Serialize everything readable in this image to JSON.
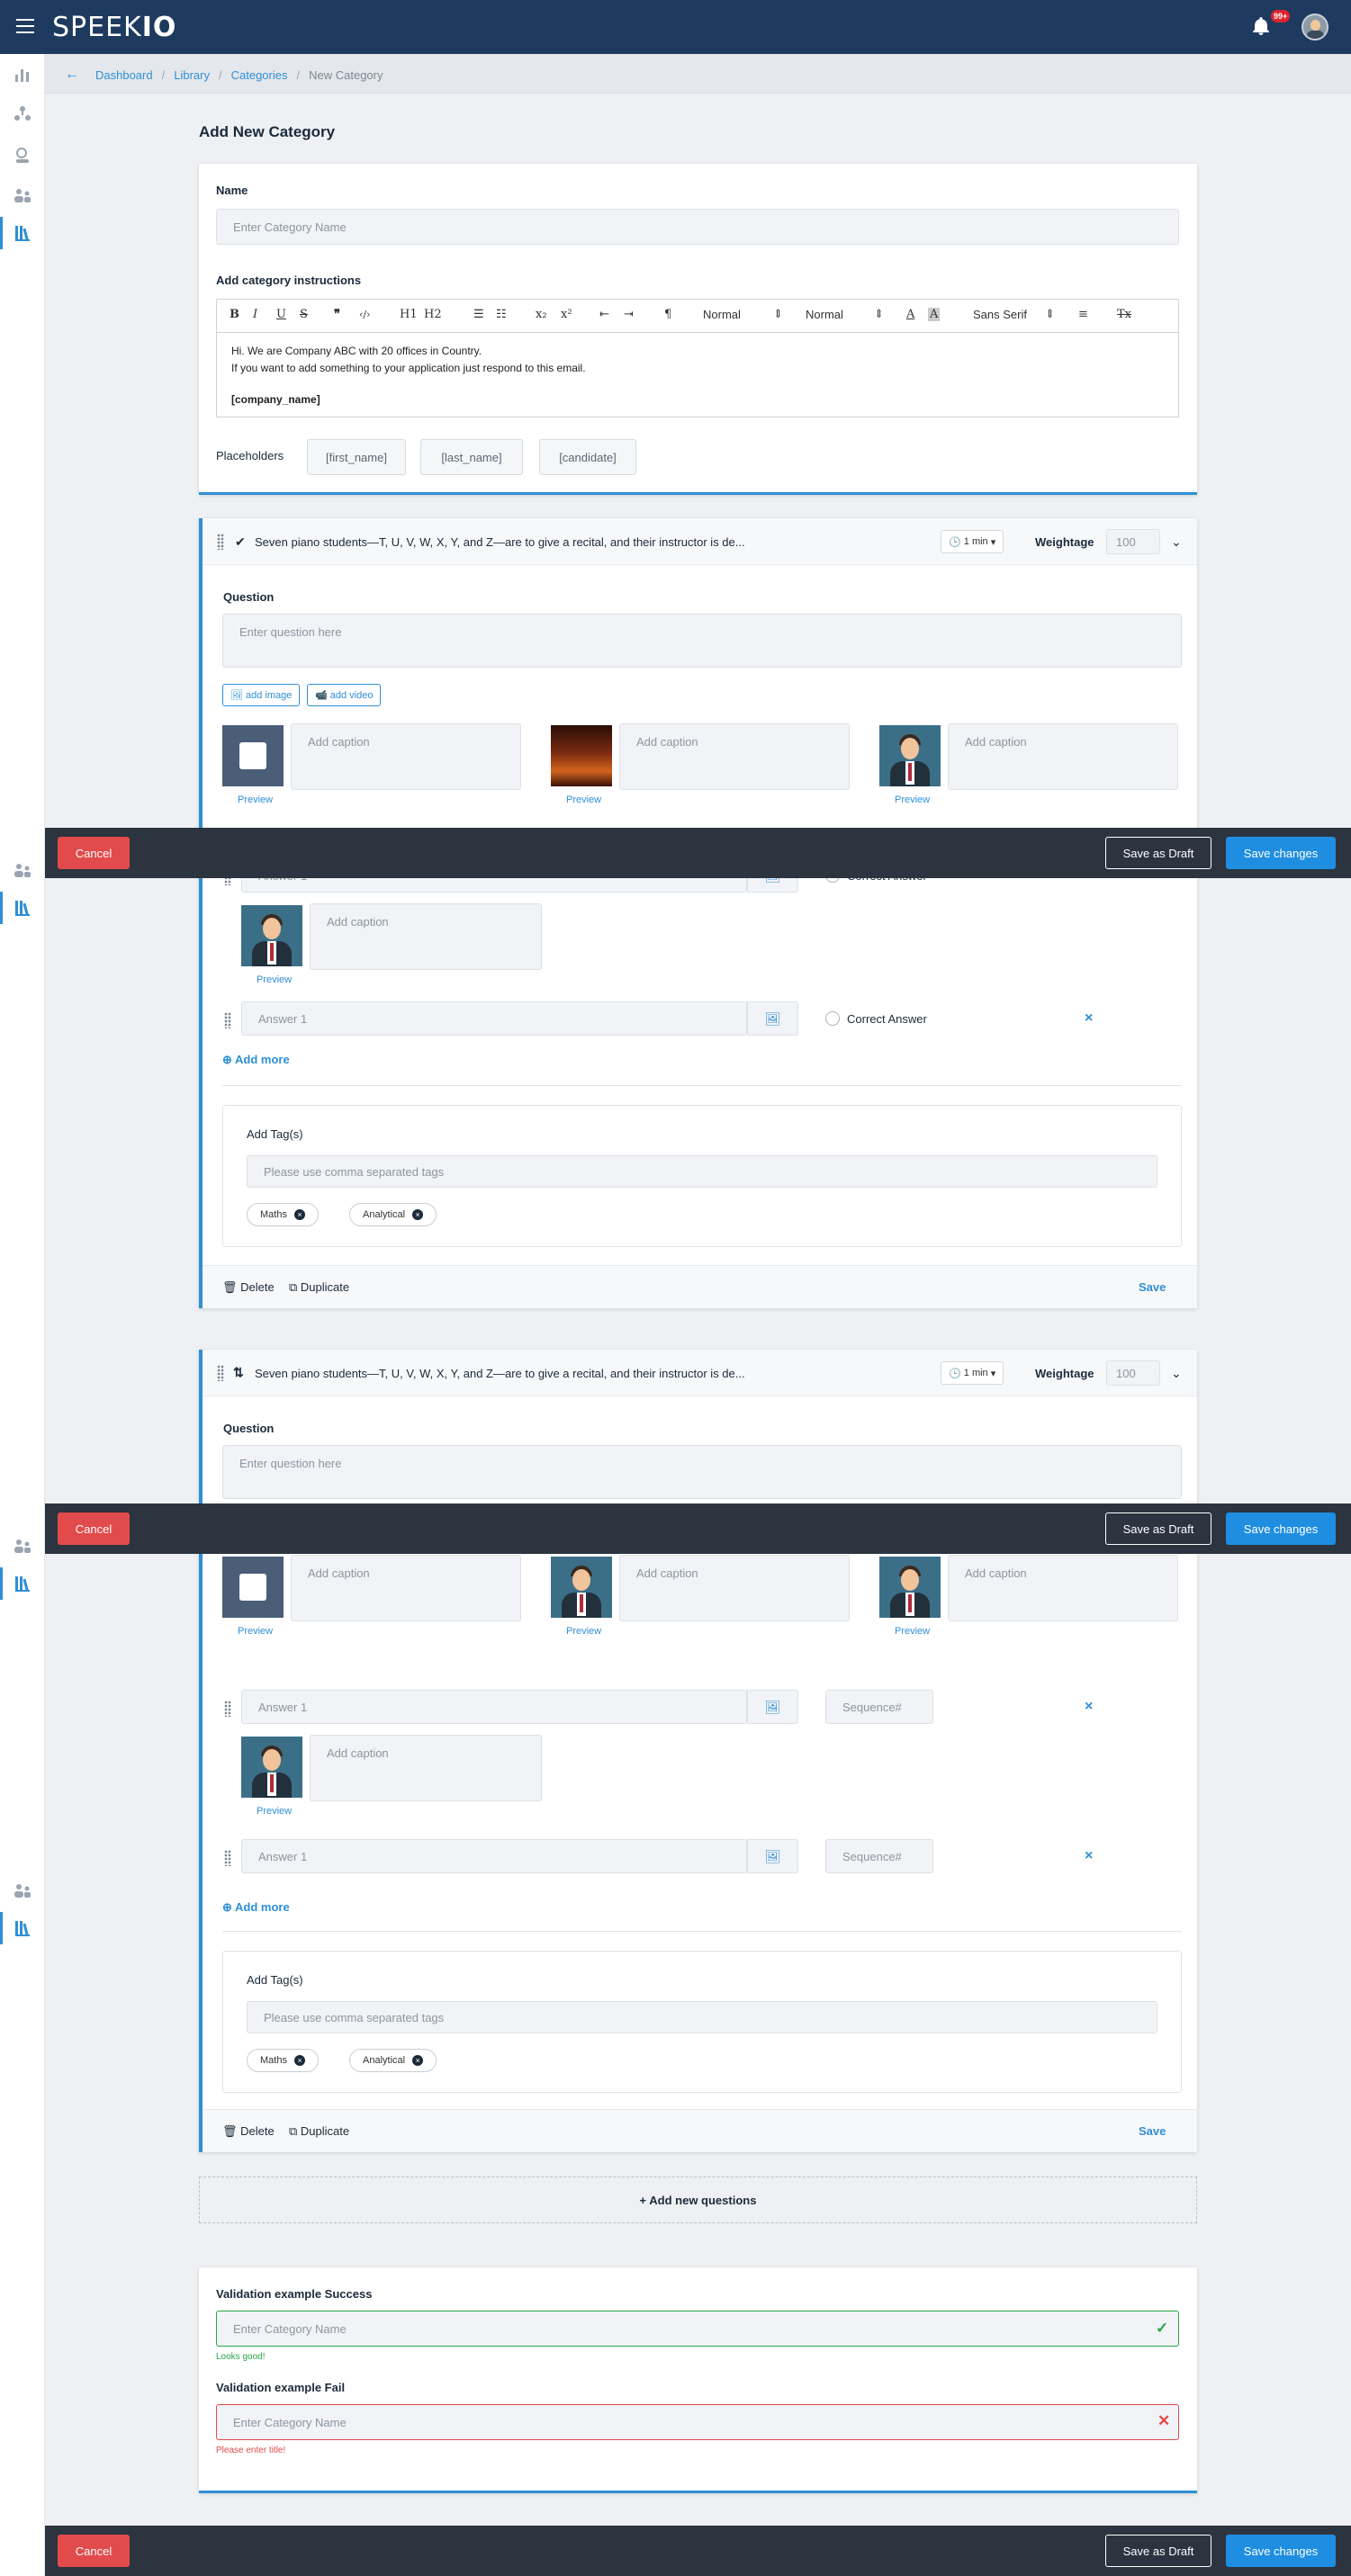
{
  "header": {
    "logo_light": "SPEEK",
    "logo_bold": "IO",
    "notif_count": "99+"
  },
  "breadcrumb": {
    "items": [
      "Dashboard",
      "Library",
      "Categories"
    ],
    "current": "New Category"
  },
  "page_title": "Add New Category",
  "category": {
    "name_label": "Name",
    "name_placeholder": "Enter Category Name",
    "instr_label": "Add category instructions",
    "toolbar": {
      "bold": "B",
      "italic": "I",
      "underline": "U",
      "strike": "S",
      "quote": "❞",
      "code": "‹/›",
      "h1": "H1",
      "h2": "H2",
      "sub": "x₂",
      "sup": "x²",
      "normal1": "Normal",
      "normal2": "Normal",
      "font": "Sans Serif",
      "clear": "Tx"
    },
    "editor_line1": "Hi. We are Company ABC with 20 offices in Country.",
    "editor_line2": "If you want to add something to your application just respond to this email.",
    "editor_line3": "[company_name]",
    "placeholders_label": "Placeholders",
    "placeholders": [
      "[first_name]",
      "[last_name]",
      "[candidate]"
    ]
  },
  "question1": {
    "text": "Seven piano students—T, U, V, W, X, Y, and Z—are to give a recital, and their instructor is de...",
    "time": "1 min",
    "weightage_label": "Weightage",
    "weightage": "100",
    "question_label": "Question",
    "question_placeholder": "Enter question here",
    "add_image": "add image",
    "add_video": "add video",
    "caption_placeholder": "Add caption",
    "preview": "Preview",
    "answer_placeholder": "Answer 1",
    "correct_answer": "Correct Answer",
    "add_more": "Add more",
    "tags_label": "Add Tag(s)",
    "tags_placeholder": "Please use comma separated tags",
    "tags": [
      "Maths",
      "Analytical"
    ],
    "delete": "Delete",
    "duplicate": "Duplicate",
    "save": "Save"
  },
  "question2": {
    "text": "Seven piano students—T, U, V, W, X, Y, and Z—are to give a recital, and their instructor is de...",
    "time": "1 min",
    "weightage_label": "Weightage",
    "weightage": "100",
    "question_label": "Question",
    "question_placeholder": "Enter question here",
    "caption_placeholder": "Add caption",
    "preview": "Preview",
    "answer_placeholder": "Answer 1",
    "sequence_placeholder": "Sequence#",
    "add_more": "Add more",
    "tags_label": "Add Tag(s)",
    "tags_placeholder": "Please use comma separated tags",
    "tags": [
      "Maths",
      "Analytical"
    ],
    "delete": "Delete",
    "duplicate": "Duplicate",
    "save": "Save"
  },
  "add_new_questions": "+ Add new questions",
  "validation": {
    "success_label": "Validation example Success",
    "success_placeholder": "Enter Category Name",
    "success_hint": "Looks good!",
    "fail_label": "Validation example Fail",
    "fail_placeholder": "Enter Category Name",
    "fail_hint": "Please enter title!"
  },
  "actions": {
    "cancel": "Cancel",
    "draft": "Save as Draft",
    "save": "Save changes"
  },
  "colors": {
    "header": "#1e3a5f",
    "accent": "#2f8fd6",
    "danger": "#e24b4b",
    "success": "#28a745",
    "actionbar": "#2c3440"
  }
}
